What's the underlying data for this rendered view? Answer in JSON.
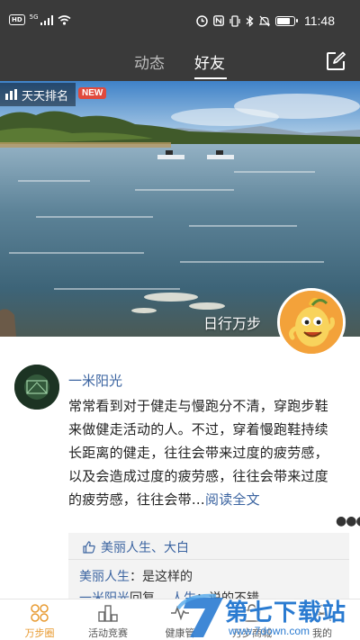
{
  "status_bar": {
    "hd_label": "HD",
    "network_label": "5G",
    "time": "11:48",
    "battery_level": 0.85
  },
  "header": {
    "tabs": [
      {
        "label": "动态",
        "active": false
      },
      {
        "label": "好友",
        "active": true
      }
    ],
    "compose_icon": "edit-square-icon"
  },
  "banner": {
    "rank_label": "天天排名",
    "new_badge": "NEW",
    "caption": "日行万步"
  },
  "post": {
    "author": "一米阳光",
    "text": "常常看到对于健走与慢跑分不清，穿跑步鞋来做健走活动的人。不过，穿着慢跑鞋持续长距离的健走，往往会带来过度的疲劳感，以及会造成过度的疲劳感，往往会带来过度的疲劳感，往往会带…",
    "read_more": "阅读全文",
    "more_icon": "more-dots-icon",
    "likes": "美丽人生、大白",
    "comments": [
      {
        "user": "美丽人生",
        "sep": "：",
        "text": "是这样的"
      },
      {
        "user": "一米阳光",
        "action": "回复",
        "reply_to": "人生",
        "sep": "：",
        "text": "说的不错"
      }
    ]
  },
  "bottom_nav": [
    {
      "label": "万步圈",
      "icon": "circle-grid-icon",
      "active": true
    },
    {
      "label": "活动竞赛",
      "icon": "podium-icon",
      "active": false
    },
    {
      "label": "健康管",
      "icon": "pulse-icon",
      "active": false
    },
    {
      "label": "万步商城",
      "icon": "shop-icon",
      "active": false
    },
    {
      "label": "我的",
      "icon": "person-icon",
      "active": false
    }
  ],
  "watermark": {
    "text": "第七下载站",
    "url": "www.7down.com"
  },
  "colors": {
    "header_bg": "#3a3a3a",
    "link_blue": "#3a63a0",
    "accent_orange": "#e89a30",
    "badge_red": "#e04a3d"
  }
}
